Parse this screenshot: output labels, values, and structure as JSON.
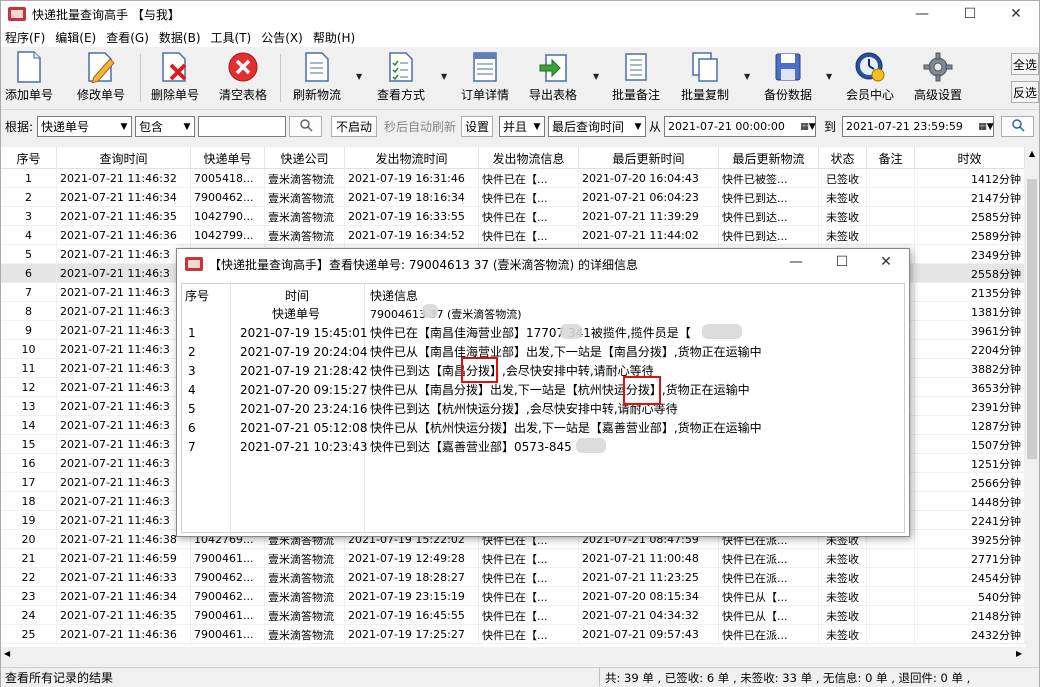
{
  "window": {
    "title": "快递批量查询高手 【与我】"
  },
  "menu": [
    "程序(F)",
    "编辑(E)",
    "查看(G)",
    "数据(B)",
    "工具(T)",
    "公告(X)",
    "帮助(H)"
  ],
  "toolbar": {
    "add": "添加单号",
    "edit": "修改单号",
    "delete": "删除单号",
    "clear": "清空表格",
    "refresh": "刷新物流",
    "view": "查看方式",
    "detail": "订单详情",
    "export": "导出表格",
    "batch_note": "批量备注",
    "batch_copy": "批量复制",
    "backup": "备份数据",
    "member": "会员中心",
    "settings": "高级设置",
    "select_all": "全选",
    "invert": "反选"
  },
  "filter": {
    "basis_label": "根据:",
    "basis_value": "快递单号",
    "match_value": "包含",
    "search_text": "",
    "auto_state": "不启动",
    "auto_label": "秒后自动刷新",
    "set_btn": "设置",
    "logic_value": "并且",
    "time_field": "最后查询时间",
    "from_label": "从",
    "from_value": "2021-07-21  00:00:00",
    "to_label": "到",
    "to_value": "2021-07-21  23:59:59"
  },
  "columns": [
    "序号",
    "查询时间",
    "快递单号",
    "快递公司",
    "发出物流时间",
    "发出物流信息",
    "最后更新时间",
    "最后更新物流",
    "状态",
    "备注",
    "时效"
  ],
  "rows": [
    {
      "n": "1",
      "q": "2021-07-21  11:46:32",
      "no": "7005418...",
      "co": "壹米滴答物流",
      "st": "2021-07-19  16:31:46",
      "si": "快件已在【...",
      "lt": "2021-07-20  16:04:43",
      "li": "快件已被签...",
      "s": "已签收",
      "r": "",
      "d": "1412分钟"
    },
    {
      "n": "2",
      "q": "2021-07-21  11:46:34",
      "no": "7900462...",
      "co": "壹米滴答物流",
      "st": "2021-07-19  18:16:34",
      "si": "快件已在【...",
      "lt": "2021-07-21  06:04:23",
      "li": "快件已到达...",
      "s": "未签收",
      "r": "",
      "d": "2147分钟"
    },
    {
      "n": "3",
      "q": "2021-07-21  11:46:35",
      "no": "1042790...",
      "co": "壹米滴答物流",
      "st": "2021-07-19  16:33:55",
      "si": "快件已在【...",
      "lt": "2021-07-21  11:39:29",
      "li": "快件已到达...",
      "s": "未签收",
      "r": "",
      "d": "2585分钟"
    },
    {
      "n": "4",
      "q": "2021-07-21  11:46:36",
      "no": "1042799...",
      "co": "壹米滴答物流",
      "st": "2021-07-19  16:34:52",
      "si": "快件已在【...",
      "lt": "2021-07-21  11:44:02",
      "li": "快件已到达...",
      "s": "未签收",
      "r": "",
      "d": "2589分钟"
    },
    {
      "n": "5",
      "q": "2021-07-21  11:46:3",
      "no": "",
      "co": "",
      "st": "",
      "si": "",
      "lt": "",
      "li": "",
      "s": "",
      "r": "",
      "d": "2349分钟"
    },
    {
      "n": "6",
      "q": "2021-07-21  11:46:3",
      "no": "",
      "co": "",
      "st": "",
      "si": "",
      "lt": "",
      "li": "",
      "s": "",
      "r": "",
      "d": "2558分钟"
    },
    {
      "n": "7",
      "q": "2021-07-21  11:46:3",
      "no": "",
      "co": "",
      "st": "",
      "si": "",
      "lt": "",
      "li": "",
      "s": "",
      "r": "",
      "d": "2135分钟"
    },
    {
      "n": "8",
      "q": "2021-07-21  11:46:3",
      "no": "",
      "co": "",
      "st": "",
      "si": "",
      "lt": "",
      "li": "",
      "s": "",
      "r": "",
      "d": "1381分钟"
    },
    {
      "n": "9",
      "q": "2021-07-21  11:46:3",
      "no": "",
      "co": "",
      "st": "",
      "si": "",
      "lt": "",
      "li": "",
      "s": "",
      "r": "",
      "d": "3961分钟"
    },
    {
      "n": "10",
      "q": "2021-07-21  11:46:3",
      "no": "",
      "co": "",
      "st": "",
      "si": "",
      "lt": "",
      "li": "",
      "s": "",
      "r": "",
      "d": "2204分钟"
    },
    {
      "n": "11",
      "q": "2021-07-21  11:46:3",
      "no": "",
      "co": "",
      "st": "",
      "si": "",
      "lt": "",
      "li": "",
      "s": "",
      "r": "",
      "d": "3882分钟"
    },
    {
      "n": "12",
      "q": "2021-07-21  11:46:3",
      "no": "",
      "co": "",
      "st": "",
      "si": "",
      "lt": "",
      "li": "",
      "s": "",
      "r": "",
      "d": "3653分钟"
    },
    {
      "n": "13",
      "q": "2021-07-21  11:46:3",
      "no": "",
      "co": "",
      "st": "",
      "si": "",
      "lt": "",
      "li": "",
      "s": "",
      "r": "",
      "d": "2391分钟"
    },
    {
      "n": "14",
      "q": "2021-07-21  11:46:3",
      "no": "",
      "co": "",
      "st": "",
      "si": "",
      "lt": "",
      "li": "",
      "s": "",
      "r": "",
      "d": "1287分钟"
    },
    {
      "n": "15",
      "q": "2021-07-21  11:46:3",
      "no": "",
      "co": "",
      "st": "",
      "si": "",
      "lt": "",
      "li": "",
      "s": "",
      "r": "",
      "d": "1507分钟"
    },
    {
      "n": "16",
      "q": "2021-07-21  11:46:3",
      "no": "",
      "co": "",
      "st": "",
      "si": "",
      "lt": "",
      "li": "",
      "s": "",
      "r": "",
      "d": "1251分钟"
    },
    {
      "n": "17",
      "q": "2021-07-21  11:46:3",
      "no": "",
      "co": "",
      "st": "",
      "si": "",
      "lt": "",
      "li": "",
      "s": "",
      "r": "",
      "d": "2566分钟"
    },
    {
      "n": "18",
      "q": "2021-07-21  11:46:3",
      "no": "",
      "co": "",
      "st": "",
      "si": "",
      "lt": "",
      "li": "",
      "s": "",
      "r": "",
      "d": "1448分钟"
    },
    {
      "n": "19",
      "q": "2021-07-21  11:46:3",
      "no": "",
      "co": "",
      "st": "",
      "si": "",
      "lt": "",
      "li": "",
      "s": "",
      "r": "",
      "d": "2241分钟"
    },
    {
      "n": "20",
      "q": "2021-07-21  11:46:38",
      "no": "1042769...",
      "co": "壹米滴答物流",
      "st": "2021-07-19  15:22:02",
      "si": "快件已在【...",
      "lt": "2021-07-21  08:47:59",
      "li": "快件已在派...",
      "s": "未签收",
      "r": "",
      "d": "3925分钟"
    },
    {
      "n": "21",
      "q": "2021-07-21  11:46:59",
      "no": "7900461...",
      "co": "壹米滴答物流",
      "st": "2021-07-19  12:49:28",
      "si": "快件已在【...",
      "lt": "2021-07-21  11:00:48",
      "li": "快件已在派...",
      "s": "未签收",
      "r": "",
      "d": "2771分钟"
    },
    {
      "n": "22",
      "q": "2021-07-21  11:46:33",
      "no": "7900462...",
      "co": "壹米滴答物流",
      "st": "2021-07-19  18:28:27",
      "si": "快件已在【...",
      "lt": "2021-07-21  11:23:25",
      "li": "快件已在派...",
      "s": "未签收",
      "r": "",
      "d": "2454分钟"
    },
    {
      "n": "23",
      "q": "2021-07-21  11:46:34",
      "no": "7900462...",
      "co": "壹米滴答物流",
      "st": "2021-07-19  23:15:19",
      "si": "快件已在【...",
      "lt": "2021-07-20  08:15:34",
      "li": "快件已从【...",
      "s": "未签收",
      "r": "",
      "d": "540分钟"
    },
    {
      "n": "24",
      "q": "2021-07-21  11:46:35",
      "no": "7900461...",
      "co": "壹米滴答物流",
      "st": "2021-07-19  16:45:55",
      "si": "快件已在【...",
      "lt": "2021-07-21  04:34:32",
      "li": "快件已从【...",
      "s": "未签收",
      "r": "",
      "d": "2148分钟"
    },
    {
      "n": "25",
      "q": "2021-07-21  11:46:36",
      "no": "7900461...",
      "co": "壹米滴答物流",
      "st": "2021-07-19  17:25:27",
      "si": "快件已在【...",
      "lt": "2021-07-21  09:57:43",
      "li": "快件已在派...",
      "s": "未签收",
      "r": "",
      "d": "2432分钟"
    }
  ],
  "status": {
    "left": "查看所有记录的结果",
    "right": "共: 39 单 , 已签收:  6 单 , 未签收:  33 单 , 无信息: 0 单 , 退回件: 0 单 ,"
  },
  "dialog": {
    "title": "【快递批量查询高手】查看快递单号: 79004613    37 (壹米滴答物流) 的详细信息",
    "col_no": "序号",
    "col_time": "时间",
    "col_info": "快递信息",
    "sub_label": "快递单号",
    "sub_value": "79004613    37 (壹米滴答物流)",
    "entries": [
      {
        "n": "1",
        "t": "2021-07-19  15:45:01",
        "info": "快件已在【南昌佳海营业部】17707    341被揽件,揽件员是【"
      },
      {
        "n": "2",
        "t": "2021-07-19  20:24:04",
        "info": "快件已从【南昌佳海营业部】出发,下一站是【南昌分拨】,货物正在运输中"
      },
      {
        "n": "3",
        "t": "2021-07-19  21:28:42",
        "info": "快件已到达【南昌分拨】,会尽快安排中转,请耐心等待"
      },
      {
        "n": "4",
        "t": "2021-07-20  09:15:27",
        "info": "快件已从【南昌分拨】出发,下一站是【杭州快运分拨】,货物正在运输中"
      },
      {
        "n": "5",
        "t": "2021-07-20  23:24:16",
        "info": "快件已到达【杭州快运分拨】,会尽快安排中转,请耐心等待"
      },
      {
        "n": "6",
        "t": "2021-07-21  05:12:08",
        "info": "快件已从【杭州快运分拨】出发,下一站是【嘉善营业部】,货物正在运输中"
      },
      {
        "n": "7",
        "t": "2021-07-21  10:23:43",
        "info": "快件已到达【嘉善营业部】0573-845"
      }
    ]
  }
}
